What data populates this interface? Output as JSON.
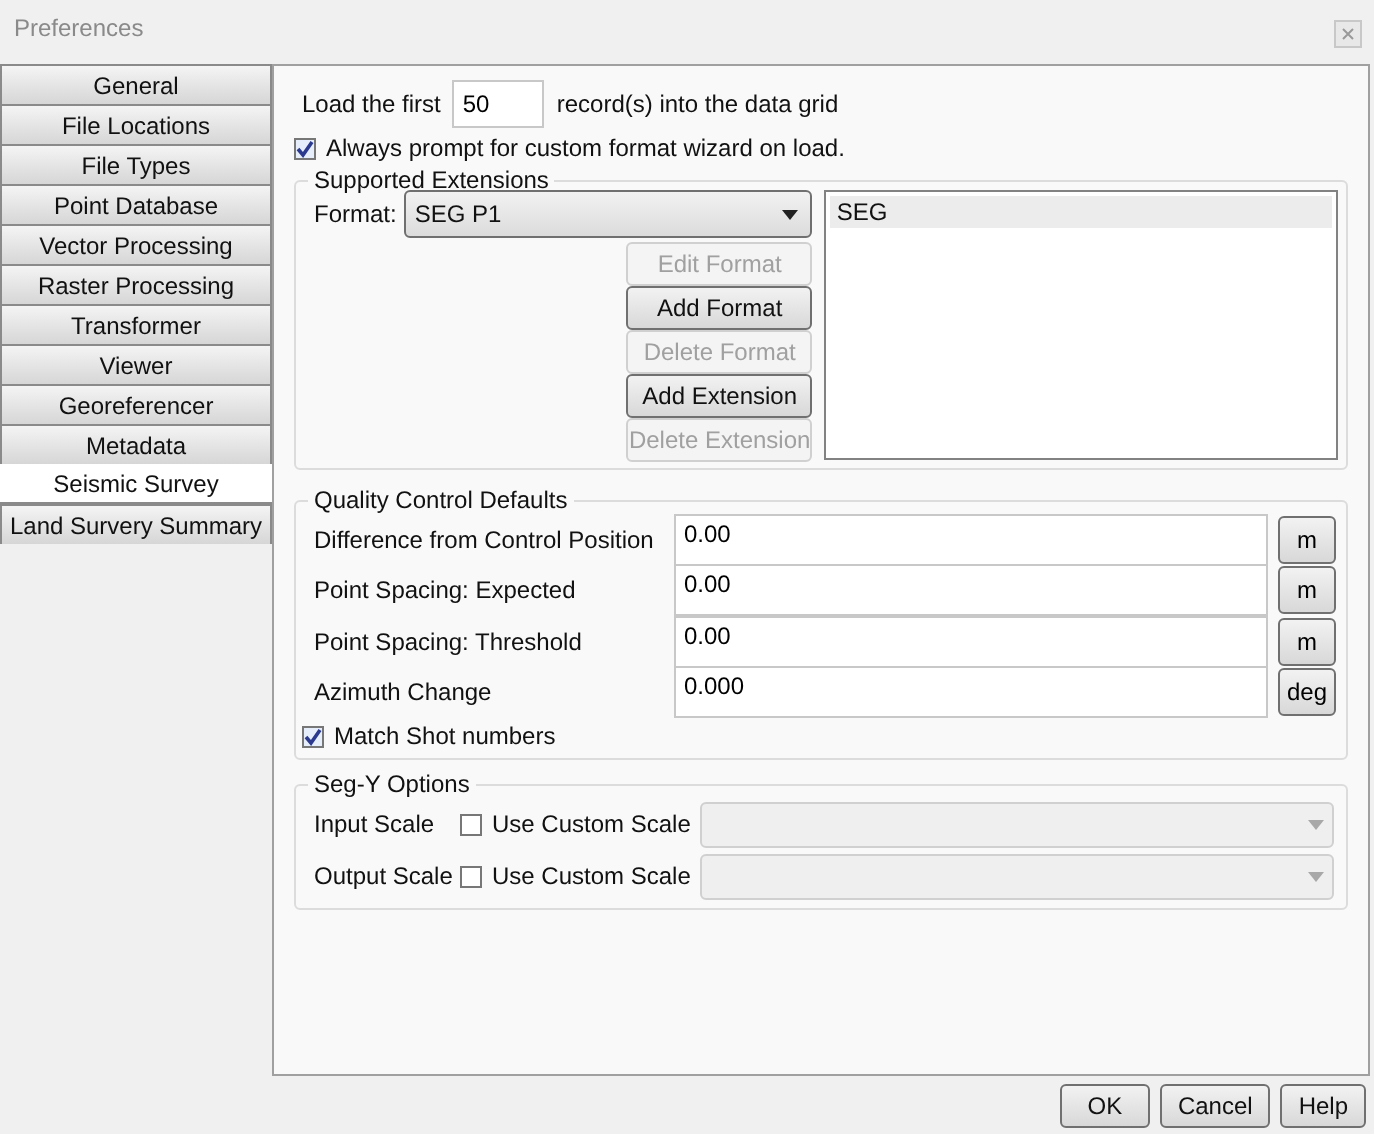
{
  "window": {
    "title": "Preferences"
  },
  "sidebar": {
    "items": [
      {
        "label": "General",
        "selected": false
      },
      {
        "label": "File Locations",
        "selected": false
      },
      {
        "label": "File Types",
        "selected": false
      },
      {
        "label": "Point Database",
        "selected": false
      },
      {
        "label": "Vector Processing",
        "selected": false
      },
      {
        "label": "Raster Processing",
        "selected": false
      },
      {
        "label": "Transformer",
        "selected": false
      },
      {
        "label": "Viewer",
        "selected": false
      },
      {
        "label": "Georeferencer",
        "selected": false
      },
      {
        "label": "Metadata",
        "selected": false
      },
      {
        "label": "Seismic Survey",
        "selected": true
      },
      {
        "label": "Land Survery Summary",
        "selected": false
      }
    ]
  },
  "records": {
    "prefix": "Load the first",
    "value": "50",
    "suffix": "record(s) into the data grid"
  },
  "prompt_wizard": {
    "label": "Always prompt for custom format wizard on load.",
    "checked": true
  },
  "supported_extensions": {
    "title": "Supported Extensions",
    "format_label": "Format:",
    "format_value": "SEG P1",
    "buttons": [
      {
        "label": "Edit Format",
        "disabled": true
      },
      {
        "label": "Add Format",
        "disabled": false
      },
      {
        "label": "Delete Format",
        "disabled": true
      },
      {
        "label": "Add Extension",
        "disabled": false
      },
      {
        "label": "Delete Extension",
        "disabled": true
      }
    ],
    "extensions": [
      {
        "label": "SEG",
        "selected": true
      }
    ]
  },
  "quality_control": {
    "title": "Quality Control Defaults",
    "fields": [
      {
        "label": "Difference from Control Position",
        "value": "0.00",
        "unit": "m"
      },
      {
        "label": "Point Spacing: Expected",
        "value": "0.00",
        "unit": "m"
      },
      {
        "label": "Point Spacing: Threshold",
        "value": "0.00",
        "unit": "m"
      },
      {
        "label": "Azimuth Change",
        "value": "0.000",
        "unit": "deg"
      }
    ],
    "match_shot": {
      "label": "Match Shot numbers",
      "checked": true
    }
  },
  "segy_options": {
    "title": "Seg-Y Options",
    "rows": [
      {
        "label": "Input Scale",
        "checkbox_label": "Use Custom Scale",
        "checked": false
      },
      {
        "label": "Output Scale",
        "checkbox_label": "Use Custom Scale",
        "checked": false
      }
    ]
  },
  "buttons": [
    "OK",
    "Cancel",
    "Help"
  ]
}
